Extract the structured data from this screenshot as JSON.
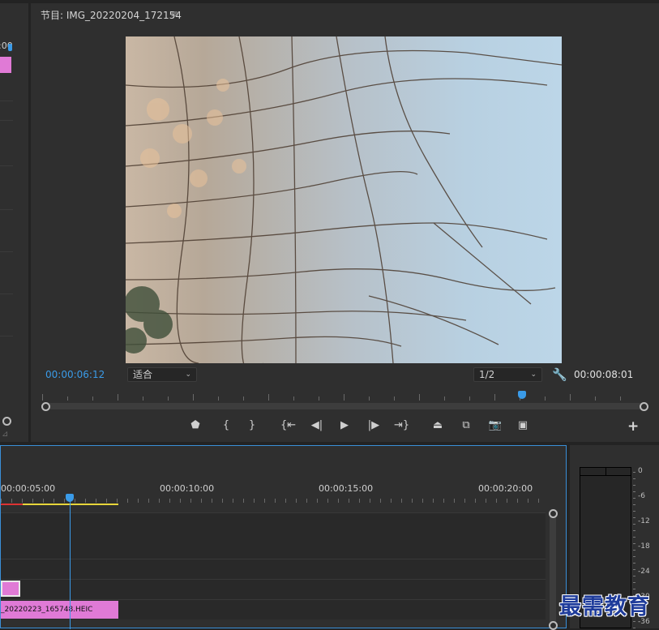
{
  "left_panel": {
    "timecode_fragment": ":00"
  },
  "monitor": {
    "title": "节目: IMG_20220204_172154",
    "menu_icon": "hamburger-menu-icon",
    "playhead_timecode": "00:00:06:12",
    "zoom_select": "适合",
    "resolution_select": "1/2",
    "duration_timecode": "00:00:08:01",
    "playhead_fraction": 0.8,
    "controls": [
      {
        "name": "add-marker-button",
        "glyph": "⬟"
      },
      {
        "name": "mark-in-button",
        "glyph": "{"
      },
      {
        "name": "mark-out-button",
        "glyph": "}"
      },
      {
        "name": "go-to-in-button",
        "glyph": "{⇤"
      },
      {
        "name": "step-back-button",
        "glyph": "◀|"
      },
      {
        "name": "play-button",
        "glyph": "▶"
      },
      {
        "name": "step-forward-button",
        "glyph": "|▶"
      },
      {
        "name": "go-to-out-button",
        "glyph": "⇥}"
      },
      {
        "name": "lift-button",
        "glyph": "⏏"
      },
      {
        "name": "extract-button",
        "glyph": "⧉"
      },
      {
        "name": "export-frame-button",
        "glyph": "📷"
      },
      {
        "name": "comparison-view-button",
        "glyph": "▣"
      }
    ],
    "add_button": "+"
  },
  "timeline": {
    "ruler_labels": [
      "00:00:05:00",
      "00:00:10:00",
      "00:00:15:00",
      "00:00:20:00"
    ],
    "clip_name": "_20220223_165748.HEIC"
  },
  "meter": {
    "db_labels": [
      "0",
      "-6",
      "-12",
      "-18",
      "-24",
      "-30",
      "-36"
    ]
  },
  "watermark": "最需教育",
  "colors": {
    "accent": "#3a9be8",
    "clip": "#e07ad6",
    "panel": "#2f2f2f",
    "work_area": "#e7d53a"
  }
}
